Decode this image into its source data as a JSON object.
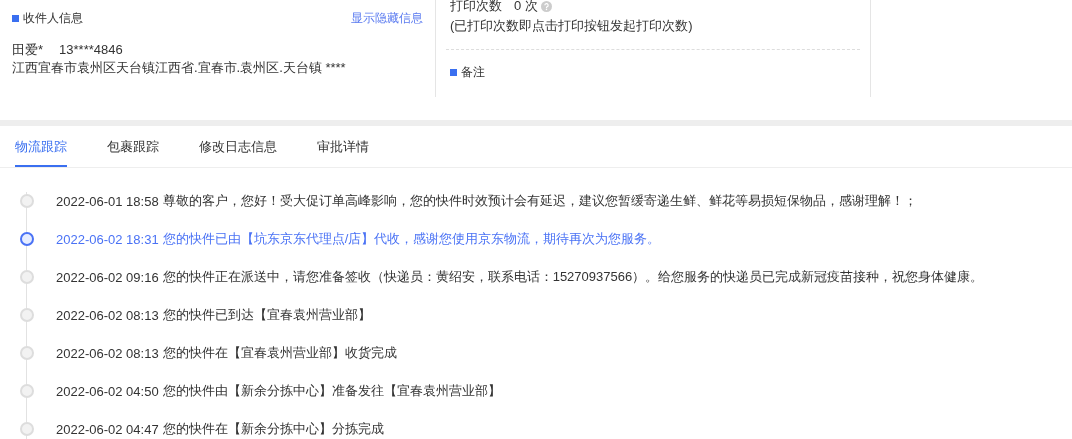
{
  "recipient": {
    "title": "收件人信息",
    "toggle_link": "显示隐藏信息",
    "name": "田爱*",
    "phone": "13****4846",
    "address": "江西宜春市袁州区天台镇江西省.宜春市.袁州区.天台镇 ****"
  },
  "print": {
    "label": "打印次数",
    "count": "0 次",
    "note": "(已打印次数即点击打印按钮发起打印次数)"
  },
  "remark": {
    "title": "备注"
  },
  "tabs": [
    {
      "label": "物流跟踪",
      "selected": true
    },
    {
      "label": "包裹跟踪",
      "selected": false
    },
    {
      "label": "修改日志信息",
      "selected": false
    },
    {
      "label": "审批详情",
      "selected": false
    }
  ],
  "events": [
    {
      "time": "2022-06-01 18:58",
      "text": "尊敬的客户，您好！受大促订单高峰影响，您的快件时效预计会有延迟，建议您暂缓寄递生鲜、鲜花等易损短保物品，感谢理解！；",
      "selected": false
    },
    {
      "time": "2022-06-02 18:31",
      "text": "您的快件已由【坑东京东代理点/店】代收，感谢您使用京东物流，期待再次为您服务。",
      "selected": true
    },
    {
      "time": "2022-06-02 09:16",
      "text": "您的快件正在派送中，请您准备签收（快递员：黄绍安，联系电话：15270937566）。给您服务的快递员已完成新冠疫苗接种，祝您身体健康。",
      "selected": false
    },
    {
      "time": "2022-06-02 08:13",
      "text": "您的快件已到达【宜春袁州营业部】",
      "selected": false
    },
    {
      "time": "2022-06-02 08:13",
      "text": "您的快件在【宜春袁州营业部】收货完成",
      "selected": false
    },
    {
      "time": "2022-06-02 04:50",
      "text": "您的快件由【新余分拣中心】准备发往【宜春袁州营业部】",
      "selected": false
    },
    {
      "time": "2022-06-02 04:47",
      "text": "您的快件在【新余分拣中心】分拣完成",
      "selected": false
    }
  ]
}
